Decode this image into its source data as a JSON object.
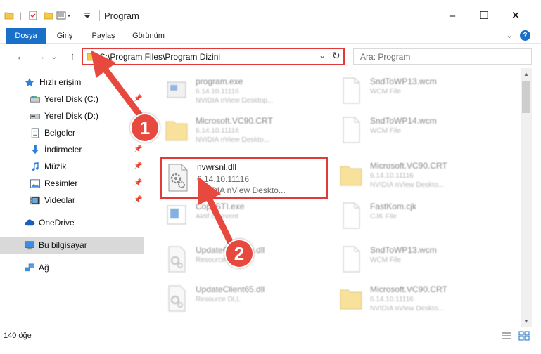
{
  "window": {
    "title": "Program",
    "minimize_label": "–",
    "maximize_label": "☐",
    "close_label": "✕"
  },
  "ribbon": {
    "tabs": [
      {
        "label": "Dosya"
      },
      {
        "label": "Giriş"
      },
      {
        "label": "Paylaş"
      },
      {
        "label": "Görünüm"
      }
    ],
    "expand_label": "⌄",
    "help_label": "?"
  },
  "navigation": {
    "back_label": "←",
    "forward_label": "→",
    "recent_label": "⌄",
    "up_label": "↑",
    "address": "C:\\Program Files\\Program Dizini",
    "address_dropdown_label": "⌄",
    "refresh_label": "↻",
    "search_placeholder": "Ara: Program"
  },
  "sidebar": {
    "items": [
      {
        "label": "Hızlı erişim",
        "icon": "star-icon"
      },
      {
        "label": "Yerel Disk (C:)",
        "icon": "drive-icon"
      },
      {
        "label": "Yerel Disk (D:)",
        "icon": "drive-icon"
      },
      {
        "label": "Belgeler",
        "icon": "documents-icon"
      },
      {
        "label": "İndirmeler",
        "icon": "download-icon"
      },
      {
        "label": "Müzik",
        "icon": "music-icon"
      },
      {
        "label": "Resimler",
        "icon": "pictures-icon"
      },
      {
        "label": "Videolar",
        "icon": "video-icon"
      },
      {
        "label": "OneDrive",
        "icon": "cloud-icon"
      },
      {
        "label": "Bu bilgisayar",
        "icon": "computer-icon"
      },
      {
        "label": "Ağ",
        "icon": "network-icon"
      }
    ],
    "pin_label": "📌"
  },
  "files": [
    {
      "name": "program.exe",
      "line1": "6.14.10.11116",
      "line2": "NVIDIA nView Desktop...",
      "icon": "exe-icon"
    },
    {
      "name": "SndToWP13.wcm",
      "line1": "WCM File",
      "line2": "",
      "icon": "generic-file-icon"
    },
    {
      "name": "Microsoft.VC90.CRT",
      "line1": "6.14.10.11116",
      "line2": "NVIDIA nView Deskto...",
      "icon": "folder-icon"
    },
    {
      "name": "SndToWP14.wcm",
      "line1": "WCM File",
      "line2": "",
      "icon": "generic-file-icon"
    },
    {
      "name": "Microsoft.VC90.CRT",
      "line1": "6.14.10.11116",
      "line2": "NVIDIA nView Deskto...",
      "icon": "folder-icon"
    },
    {
      "name": "CopySTI.exe",
      "line1": "Aktif on event",
      "line2": "",
      "icon": "exe-icon"
    },
    {
      "name": "FastKom.cjk",
      "line1": "CJK File",
      "line2": "",
      "icon": "generic-file-icon"
    },
    {
      "name": "UpdateClient50.dll",
      "line1": "Resource DLL",
      "line2": "",
      "icon": "dll-icon"
    },
    {
      "name": "SndToWP13.wcm",
      "line1": "WCM File",
      "line2": "",
      "icon": "generic-file-icon"
    },
    {
      "name": "UpdateClient65.dll",
      "line1": "Resource DLL",
      "line2": "",
      "icon": "dll-icon"
    },
    {
      "name": "Microsoft.VC90.CRT",
      "line1": "6.14.10.11116",
      "line2": "NVIDIA nView Deskto...",
      "icon": "folder-icon"
    }
  ],
  "highlighted_file": {
    "name": "nvwrsnl.dll",
    "version": "6.14.10.11116",
    "description": "NVIDIA nView Deskto...",
    "icon": "dll-icon"
  },
  "callouts": [
    "1",
    "2"
  ],
  "status": {
    "count": "140 öğe"
  },
  "colors": {
    "accent": "#1a6fc9",
    "highlight": "#e23a3a",
    "callout": "#e8493f"
  }
}
